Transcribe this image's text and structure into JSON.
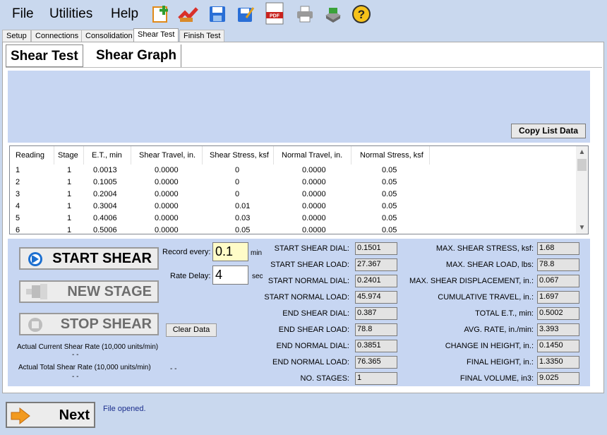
{
  "menu": {
    "file": "File",
    "utilities": "Utilities",
    "help": "Help"
  },
  "toolbar": [
    "new-icon",
    "open-icon",
    "save-icon",
    "save-as-icon",
    "pdf-icon",
    "print-icon",
    "export-icon",
    "help-icon"
  ],
  "tabs": [
    "Setup",
    "Connections",
    "Consolidation",
    "Shear Test",
    "Finish Test"
  ],
  "active_tab": "Shear Test",
  "subtabs": [
    "Shear Test",
    "Shear Graph"
  ],
  "copy_button": "Copy List Data",
  "list": {
    "headers": [
      "Reading",
      "Stage",
      "E.T., min",
      "Shear Travel, in.",
      "Shear Stress, ksf",
      "Normal Travel, in.",
      "Normal Stress, ksf"
    ],
    "rows": [
      [
        "1",
        "1",
        "0.0013",
        "0.0000",
        "0",
        "0.0000",
        "0.05"
      ],
      [
        "2",
        "1",
        "0.1005",
        "0.0000",
        "0",
        "0.0000",
        "0.05"
      ],
      [
        "3",
        "1",
        "0.2004",
        "0.0000",
        "0",
        "0.0000",
        "0.05"
      ],
      [
        "4",
        "1",
        "0.3004",
        "0.0000",
        "0.01",
        "0.0000",
        "0.05"
      ],
      [
        "5",
        "1",
        "0.4006",
        "0.0000",
        "0.03",
        "0.0000",
        "0.05"
      ],
      [
        "6",
        "1",
        "0.5006",
        "0.0000",
        "0.05",
        "0.0000",
        "0.05"
      ]
    ]
  },
  "controls": {
    "start_shear": "START SHEAR",
    "new_stage": "NEW STAGE",
    "stop_shear": "STOP SHEAR",
    "clear_data": "Clear Data",
    "record_every_label": "Record every:",
    "record_every_value": "0.1",
    "record_every_unit": "min",
    "rate_delay_label": "Rate Delay:",
    "rate_delay_value": "4",
    "rate_delay_unit": "sec",
    "actual_current_rate_label": "Actual Current Shear Rate (10,000 units/min)",
    "actual_current_rate_value": "- -",
    "actual_total_rate_label": "Actual Total Shear Rate (10,000 units/min)",
    "actual_total_rate_value": "- -",
    "actual_total_rate_value2": "- -"
  },
  "fields_mid": [
    {
      "label": "START SHEAR DIAL:",
      "value": "0.1501"
    },
    {
      "label": "START SHEAR LOAD:",
      "value": "27.367"
    },
    {
      "label": "START NORMAL DIAL:",
      "value": "0.2401"
    },
    {
      "label": "START NORMAL LOAD:",
      "value": "45.974"
    },
    {
      "label": "END SHEAR DIAL:",
      "value": "0.387"
    },
    {
      "label": "END SHEAR LOAD:",
      "value": "78.8"
    },
    {
      "label": "END NORMAL DIAL:",
      "value": "0.3851"
    },
    {
      "label": "END NORMAL LOAD:",
      "value": "76.365"
    },
    {
      "label": "NO. STAGES:",
      "value": "1"
    }
  ],
  "fields_right": [
    {
      "label": "MAX. SHEAR STRESS, ksf:",
      "value": "1.68"
    },
    {
      "label": "MAX. SHEAR LOAD, lbs:",
      "value": "78.8"
    },
    {
      "label": "MAX. SHEAR DISPLACEMENT, in.:",
      "value": "0.067"
    },
    {
      "label": "CUMULATIVE TRAVEL, in.:",
      "value": "1.697"
    },
    {
      "label": "TOTAL E.T., min:",
      "value": "0.5002"
    },
    {
      "label": "AVG. RATE, in./min:",
      "value": "3.393"
    },
    {
      "label": "CHANGE IN HEIGHT, in.:",
      "value": "0.1450"
    },
    {
      "label": "FINAL HEIGHT, in.:",
      "value": "1.3350"
    },
    {
      "label": "FINAL VOLUME, in3:",
      "value": "9.025"
    }
  ],
  "next_button": "Next",
  "status": "File opened."
}
